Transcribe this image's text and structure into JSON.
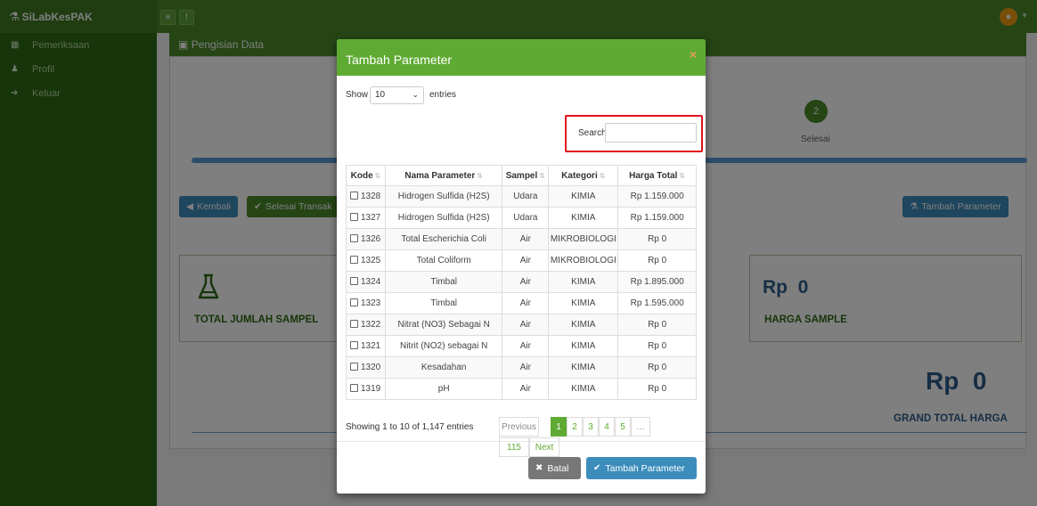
{
  "app": {
    "brand": "SiLabKesPAK"
  },
  "sidebar": {
    "items": [
      {
        "label": "Pemeriksaan",
        "icon": "table-icon"
      },
      {
        "label": "Profil",
        "icon": "user-icon"
      },
      {
        "label": "Keluar",
        "icon": "sign-out-icon"
      }
    ]
  },
  "page": {
    "panel_title": "Pengisian Data",
    "step_number": "2",
    "step_label": "Selesai",
    "back_button": "Kembali",
    "finish_button": "Selesai Transaksi",
    "add_param_button": "Tambah Parameter",
    "total_sample_label": "TOTAL JUMLAH SAMPEL",
    "harga_rp": "Rp  0",
    "harga_label": "HARGA SAMPLE",
    "grand_rp": "Rp  0",
    "grand_label": "GRAND TOTAL HARGA"
  },
  "modal": {
    "title": "Tambah Parameter",
    "close": "×",
    "show_label": "Show",
    "length_value": "10",
    "entries_label": "entries",
    "search_label": "Search:",
    "search_value": "",
    "columns": [
      "Kode",
      "Nama Parameter",
      "Sampel",
      "Kategori",
      "Harga Total"
    ],
    "rows": [
      {
        "kode": "1328",
        "nama": "Hidrogen Sulfida (H2S)",
        "sampel": "Udara",
        "kategori": "KIMIA",
        "harga": "Rp 1.159.000"
      },
      {
        "kode": "1327",
        "nama": "Hidrogen Sulfida (H2S)",
        "sampel": "Udara",
        "kategori": "KIMIA",
        "harga": "Rp 1.159.000"
      },
      {
        "kode": "1326",
        "nama": "Total Escherichia Coli",
        "sampel": "Air",
        "kategori": "MIKROBIOLOGI",
        "harga": "Rp 0"
      },
      {
        "kode": "1325",
        "nama": "Total Coliform",
        "sampel": "Air",
        "kategori": "MIKROBIOLOGI",
        "harga": "Rp 0"
      },
      {
        "kode": "1324",
        "nama": "Timbal",
        "sampel": "Air",
        "kategori": "KIMIA",
        "harga": "Rp 1.895.000"
      },
      {
        "kode": "1323",
        "nama": "Timbal",
        "sampel": "Air",
        "kategori": "KIMIA",
        "harga": "Rp 1.595.000"
      },
      {
        "kode": "1322",
        "nama": "Nitrat (NO3) Sebagai N",
        "sampel": "Air",
        "kategori": "KIMIA",
        "harga": "Rp 0"
      },
      {
        "kode": "1321",
        "nama": "Nitrit (NO2) sebagai N",
        "sampel": "Air",
        "kategori": "KIMIA",
        "harga": "Rp 0"
      },
      {
        "kode": "1320",
        "nama": "Kesadahan",
        "sampel": "Air",
        "kategori": "KIMIA",
        "harga": "Rp 0"
      },
      {
        "kode": "1319",
        "nama": "pH",
        "sampel": "Air",
        "kategori": "KIMIA",
        "harga": "Rp 0"
      }
    ],
    "info": "Showing 1 to 10 of 1,147 entries",
    "pagination": {
      "previous": "Previous",
      "pages": [
        "1",
        "2",
        "3",
        "4",
        "5"
      ],
      "ellipsis": "…",
      "last": "115",
      "next": "Next",
      "current": "1"
    },
    "cancel_button": "Batal",
    "submit_button": "Tambah Parameter"
  },
  "colors": {
    "navbar": "#4a8a2a",
    "sidebar": "#2d6b14",
    "modal_header": "#5faa32",
    "primary": "#3c8dbc",
    "highlight": "#e0131e"
  }
}
